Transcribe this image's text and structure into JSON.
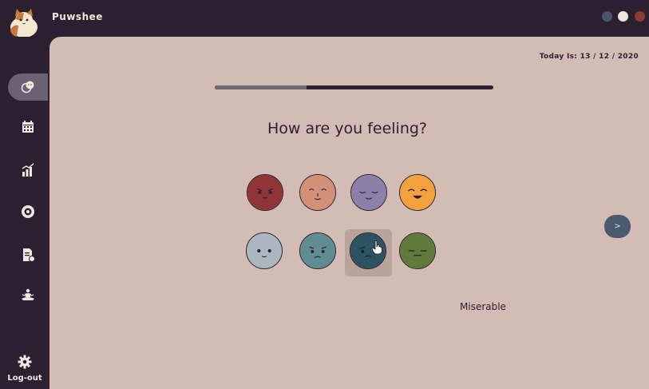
{
  "app": {
    "title": "Puwshee"
  },
  "header": {
    "date_text": "Today Is: 13 / 12 / 2020"
  },
  "sidebar": {
    "items": [
      {
        "icon": "mood-icon",
        "active": true
      },
      {
        "icon": "calendar-icon",
        "active": false
      },
      {
        "icon": "stats-icon",
        "active": false
      },
      {
        "icon": "record-icon",
        "active": false
      },
      {
        "icon": "report-icon",
        "active": false
      },
      {
        "icon": "meditation-icon",
        "active": false
      }
    ],
    "logout_label": "Log-out"
  },
  "main": {
    "progress": 0.33,
    "question": "How are you feeling?",
    "selected_mood_label": "Miserable",
    "next_label": ">"
  },
  "colors": {
    "angry": "#8f3535",
    "shy": "#d29079",
    "calm": "#8c80a8",
    "happy": "#f2a13c",
    "neutral": "#aab7bf",
    "sad": "#5f8d91",
    "miserable": "#2c5361",
    "sick": "#5f7a3a"
  }
}
